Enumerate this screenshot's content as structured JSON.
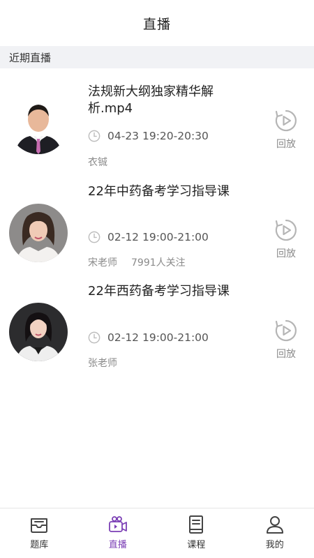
{
  "header": {
    "title": "直播"
  },
  "section": {
    "title": "近期直播"
  },
  "colors": {
    "accent": "#7b3fb5",
    "icon_gray": "#b5b5b5",
    "section_bg": "#f1f2f5"
  },
  "lives": [
    {
      "title": "法规新大纲独家精华解析.mp4",
      "time": "04-23 19:20-20:30",
      "teacher": "衣铖",
      "followers": "",
      "replay_label": "回放"
    },
    {
      "title": "22年中药备考学习指导课",
      "time": "02-12 19:00-21:00",
      "teacher": "宋老师",
      "followers": "7991人关注",
      "replay_label": "回放"
    },
    {
      "title": "22年西药备考学习指导课",
      "time": "02-12 19:00-21:00",
      "teacher": "张老师",
      "followers": "",
      "replay_label": "回放"
    }
  ],
  "tabs": [
    {
      "label": "题库",
      "icon": "question-bank-icon",
      "active": false
    },
    {
      "label": "直播",
      "icon": "live-camera-icon",
      "active": true
    },
    {
      "label": "课程",
      "icon": "course-book-icon",
      "active": false
    },
    {
      "label": "我的",
      "icon": "profile-icon",
      "active": false
    }
  ]
}
